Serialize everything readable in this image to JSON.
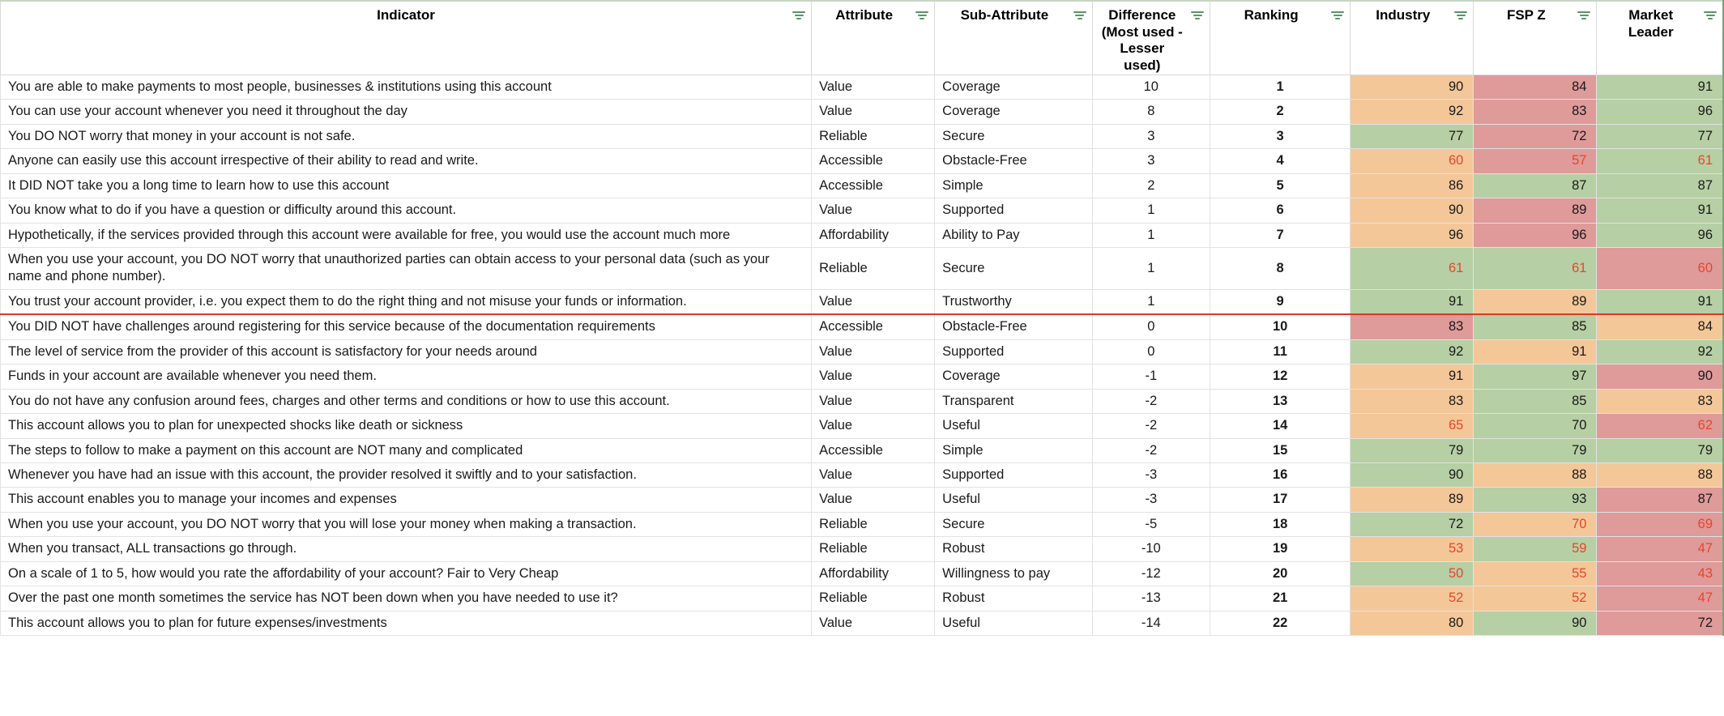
{
  "accent": {
    "filter_icon_color": "#5a9367",
    "separator_line_color": "#d93b22",
    "green_fill": "#b6cfa4",
    "orange_fill": "#f4c799",
    "red_fill": "#df9a9a",
    "low_value_text": "#e8462a"
  },
  "table": {
    "columns": [
      {
        "key": "indicator",
        "label": "Indicator",
        "filter_icon": "filter-icon"
      },
      {
        "key": "attribute",
        "label": "Attribute",
        "filter_icon": "filter-icon"
      },
      {
        "key": "sub_attribute",
        "label": "Sub-Attribute",
        "filter_icon": "filter-icon"
      },
      {
        "key": "difference",
        "label": "Difference (Most used - Lesser used)",
        "label_line1": "Difference",
        "label_line2": "(Most used -",
        "label_line3": "Lesser used)",
        "filter_icon": "filter-icon"
      },
      {
        "key": "ranking",
        "label": "Ranking",
        "filter_icon": "filter-icon"
      },
      {
        "key": "industry",
        "label": "Industry",
        "filter_icon": "filter-icon"
      },
      {
        "key": "fsp_z",
        "label": "FSP Z",
        "filter_icon": "filter-icon"
      },
      {
        "key": "market_leader",
        "label": "Market Leader",
        "label_line1": "Market",
        "label_line2": "Leader",
        "filter_icon": "filter-icon"
      }
    ],
    "rows": [
      {
        "indicator": "You are able to make payments to most people, businesses & institutions using this account",
        "attribute": "Value",
        "sub_attribute": "Coverage",
        "difference": "10",
        "ranking": "1",
        "industry": "90",
        "industry_fill": "orange",
        "industry_low": false,
        "fsp_z": "84",
        "fsp_z_fill": "red",
        "fsp_z_low": false,
        "market_leader": "91",
        "market_leader_fill": "green",
        "market_leader_low": false
      },
      {
        "indicator": "You can use your account whenever you need it throughout  the day",
        "attribute": "Value",
        "sub_attribute": "Coverage",
        "difference": "8",
        "ranking": "2",
        "industry": "92",
        "industry_fill": "orange",
        "industry_low": false,
        "fsp_z": "83",
        "fsp_z_fill": "red",
        "fsp_z_low": false,
        "market_leader": "96",
        "market_leader_fill": "green",
        "market_leader_low": false
      },
      {
        "indicator": "You DO NOT worry that money in your account is not safe.",
        "attribute": "Reliable",
        "sub_attribute": "Secure",
        "difference": "3",
        "ranking": "3",
        "industry": "77",
        "industry_fill": "green",
        "industry_low": false,
        "fsp_z": "72",
        "fsp_z_fill": "red",
        "fsp_z_low": false,
        "market_leader": "77",
        "market_leader_fill": "green",
        "market_leader_low": false
      },
      {
        "indicator": "Anyone can easily use this account irrespective of their ability to read and write.",
        "attribute": "Accessible",
        "sub_attribute": "Obstacle-Free",
        "difference": "3",
        "ranking": "4",
        "industry": "60",
        "industry_fill": "orange",
        "industry_low": true,
        "fsp_z": "57",
        "fsp_z_fill": "red",
        "fsp_z_low": true,
        "market_leader": "61",
        "market_leader_fill": "green",
        "market_leader_low": true
      },
      {
        "indicator": "It DID NOT take you a long time to learn how to use this account",
        "attribute": "Accessible",
        "sub_attribute": "Simple",
        "difference": "2",
        "ranking": "5",
        "industry": "86",
        "industry_fill": "orange",
        "industry_low": false,
        "fsp_z": "87",
        "fsp_z_fill": "green",
        "fsp_z_low": false,
        "market_leader": "87",
        "market_leader_fill": "green",
        "market_leader_low": false
      },
      {
        "indicator": "You know what to do if you have a question or difficulty around this account.",
        "attribute": "Value",
        "sub_attribute": "Supported",
        "difference": "1",
        "ranking": "6",
        "industry": "90",
        "industry_fill": "orange",
        "industry_low": false,
        "fsp_z": "89",
        "fsp_z_fill": "red",
        "fsp_z_low": false,
        "market_leader": "91",
        "market_leader_fill": "green",
        "market_leader_low": false
      },
      {
        "indicator": "Hypothetically, if the services provided through this account were available for free, you would use the account much more",
        "attribute": "Affordability",
        "sub_attribute": "Ability to Pay",
        "difference": "1",
        "ranking": "7",
        "industry": "96",
        "industry_fill": "orange",
        "industry_low": false,
        "fsp_z": "96",
        "fsp_z_fill": "red",
        "fsp_z_low": false,
        "market_leader": "96",
        "market_leader_fill": "green",
        "market_leader_low": false
      },
      {
        "indicator": "When you use your account, you DO NOT worry that unauthorized parties can obtain access to your personal data (such as your name and phone number).",
        "attribute": "Reliable",
        "sub_attribute": "Secure",
        "difference": "1",
        "ranking": "8",
        "industry": "61",
        "industry_fill": "green",
        "industry_low": true,
        "fsp_z": "61",
        "fsp_z_fill": "green",
        "fsp_z_low": true,
        "market_leader": "60",
        "market_leader_fill": "red",
        "market_leader_low": true
      },
      {
        "indicator": "You trust your account provider, i.e. you expect them to do the right thing and not misuse your funds or information.",
        "attribute": "Value",
        "sub_attribute": "Trustworthy",
        "difference": "1",
        "ranking": "9",
        "industry": "91",
        "industry_fill": "green",
        "industry_low": false,
        "fsp_z": "89",
        "fsp_z_fill": "orange",
        "fsp_z_low": false,
        "market_leader": "91",
        "market_leader_fill": "green",
        "market_leader_low": false,
        "separator_below": true
      },
      {
        "indicator": "You DID NOT have challenges around registering for this service because of the documentation requirements",
        "attribute": "Accessible",
        "sub_attribute": "Obstacle-Free",
        "difference": "0",
        "ranking": "10",
        "industry": "83",
        "industry_fill": "red",
        "industry_low": false,
        "fsp_z": "85",
        "fsp_z_fill": "green",
        "fsp_z_low": false,
        "market_leader": "84",
        "market_leader_fill": "orange",
        "market_leader_low": false
      },
      {
        "indicator": "The level of service from the provider of this account is satisfactory for your needs around",
        "attribute": "Value",
        "sub_attribute": "Supported",
        "difference": "0",
        "ranking": "11",
        "industry": "92",
        "industry_fill": "green",
        "industry_low": false,
        "fsp_z": "91",
        "fsp_z_fill": "orange",
        "fsp_z_low": false,
        "market_leader": "92",
        "market_leader_fill": "green",
        "market_leader_low": false
      },
      {
        "indicator": "Funds in your account are available whenever you need them.",
        "attribute": "Value",
        "sub_attribute": "Coverage",
        "difference": "-1",
        "ranking": "12",
        "industry": "91",
        "industry_fill": "orange",
        "industry_low": false,
        "fsp_z": "97",
        "fsp_z_fill": "green",
        "fsp_z_low": false,
        "market_leader": "90",
        "market_leader_fill": "red",
        "market_leader_low": false
      },
      {
        "indicator": "You do not have any confusion around fees, charges and other terms and conditions or how to use this account.",
        "attribute": "Value",
        "sub_attribute": "Transparent",
        "difference": "-2",
        "ranking": "13",
        "industry": "83",
        "industry_fill": "orange",
        "industry_low": false,
        "fsp_z": "85",
        "fsp_z_fill": "green",
        "fsp_z_low": false,
        "market_leader": "83",
        "market_leader_fill": "orange",
        "market_leader_low": false
      },
      {
        "indicator": "This account allows you to plan for unexpected shocks like death or sickness",
        "attribute": "Value",
        "sub_attribute": "Useful",
        "difference": "-2",
        "ranking": "14",
        "industry": "65",
        "industry_fill": "orange",
        "industry_low": true,
        "fsp_z": "70",
        "fsp_z_fill": "green",
        "fsp_z_low": false,
        "market_leader": "62",
        "market_leader_fill": "red",
        "market_leader_low": true
      },
      {
        "indicator": "The steps to follow to make a payment on this account are NOT many and complicated",
        "attribute": "Accessible",
        "sub_attribute": "Simple",
        "difference": "-2",
        "ranking": "15",
        "industry": "79",
        "industry_fill": "green",
        "industry_low": false,
        "fsp_z": "79",
        "fsp_z_fill": "green",
        "fsp_z_low": false,
        "market_leader": "79",
        "market_leader_fill": "green",
        "market_leader_low": false
      },
      {
        "indicator": "Whenever you have had an issue with this account, the provider resolved it swiftly and to your satisfaction.",
        "attribute": "Value",
        "sub_attribute": "Supported",
        "difference": "-3",
        "ranking": "16",
        "industry": "90",
        "industry_fill": "green",
        "industry_low": false,
        "fsp_z": "88",
        "fsp_z_fill": "orange",
        "fsp_z_low": false,
        "market_leader": "88",
        "market_leader_fill": "orange",
        "market_leader_low": false
      },
      {
        "indicator": "This account enables you to manage your incomes and expenses",
        "attribute": "Value",
        "sub_attribute": "Useful",
        "difference": "-3",
        "ranking": "17",
        "industry": "89",
        "industry_fill": "orange",
        "industry_low": false,
        "fsp_z": "93",
        "fsp_z_fill": "green",
        "fsp_z_low": false,
        "market_leader": "87",
        "market_leader_fill": "red",
        "market_leader_low": false
      },
      {
        "indicator": "When you use your account, you DO NOT worry that you will lose your money when making a transaction.",
        "attribute": "Reliable",
        "sub_attribute": "Secure",
        "difference": "-5",
        "ranking": "18",
        "industry": "72",
        "industry_fill": "green",
        "industry_low": false,
        "fsp_z": "70",
        "fsp_z_fill": "orange",
        "fsp_z_low": true,
        "market_leader": "69",
        "market_leader_fill": "red",
        "market_leader_low": true
      },
      {
        "indicator": "When you transact, ALL transactions go through.",
        "attribute": "Reliable",
        "sub_attribute": "Robust",
        "difference": "-10",
        "ranking": "19",
        "industry": "53",
        "industry_fill": "orange",
        "industry_low": true,
        "fsp_z": "59",
        "fsp_z_fill": "green",
        "fsp_z_low": true,
        "market_leader": "47",
        "market_leader_fill": "red",
        "market_leader_low": true
      },
      {
        "indicator": "On a scale of 1 to 5, how would you rate the affordability of your account? Fair to Very Cheap",
        "attribute": "Affordability",
        "sub_attribute": "Willingness to pay",
        "difference": "-12",
        "ranking": "20",
        "industry": "50",
        "industry_fill": "green",
        "industry_low": true,
        "fsp_z": "55",
        "fsp_z_fill": "orange",
        "fsp_z_low": true,
        "market_leader": "43",
        "market_leader_fill": "red",
        "market_leader_low": true
      },
      {
        "indicator": "Over the past one month sometimes the service has NOT been down when you have needed to use it?",
        "attribute": "Reliable",
        "sub_attribute": "Robust",
        "difference": "-13",
        "ranking": "21",
        "industry": "52",
        "industry_fill": "orange",
        "industry_low": true,
        "fsp_z": "52",
        "fsp_z_fill": "orange",
        "fsp_z_low": true,
        "market_leader": "47",
        "market_leader_fill": "red",
        "market_leader_low": true
      },
      {
        "indicator": "This account allows you to plan for future expenses/investments",
        "attribute": "Value",
        "sub_attribute": "Useful",
        "difference": "-14",
        "ranking": "22",
        "industry": "80",
        "industry_fill": "orange",
        "industry_low": false,
        "fsp_z": "90",
        "fsp_z_fill": "green",
        "fsp_z_low": false,
        "market_leader": "72",
        "market_leader_fill": "red",
        "market_leader_low": false
      }
    ]
  }
}
